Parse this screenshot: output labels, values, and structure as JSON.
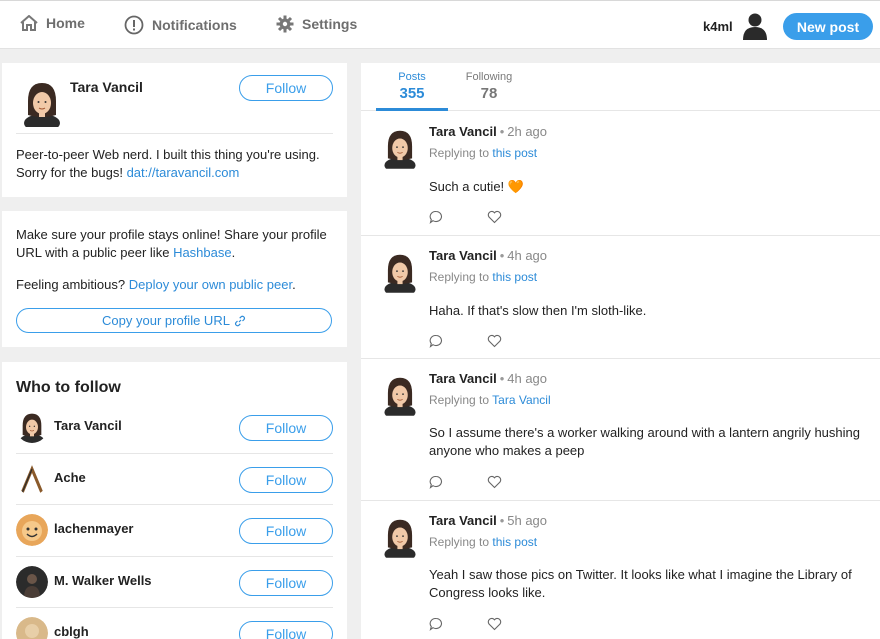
{
  "nav": {
    "home": "Home",
    "notifications": "Notifications",
    "settings": "Settings",
    "username": "k4ml",
    "new_post": "New post"
  },
  "profile": {
    "name": "Tara Vancil",
    "follow_label": "Follow",
    "bio": "Peer-to-peer Web nerd. I built this thing you're using. Sorry for the bugs!",
    "bio_link": "dat://taravancil.com"
  },
  "share": {
    "text1": "Make sure your profile stays online! Share your profile URL with a public peer like",
    "hashbase": "Hashbase",
    "text2": "Feeling ambitious?",
    "deploy_link": "Deploy your own public peer",
    "copy_btn": "Copy your profile URL"
  },
  "who_to_follow": {
    "title": "Who to follow",
    "items": [
      {
        "name": "Tara Vancil",
        "button": "Follow"
      },
      {
        "name": "Ache",
        "button": "Follow"
      },
      {
        "name": "lachenmayer",
        "button": "Follow"
      },
      {
        "name": "M. Walker Wells",
        "button": "Follow"
      },
      {
        "name": "cblgh",
        "button": "Follow"
      }
    ]
  },
  "tabs": {
    "posts_label": "Posts",
    "posts_count": "355",
    "following_label": "Following",
    "following_count": "78"
  },
  "posts": [
    {
      "author": "Tara Vancil",
      "time": "2h ago",
      "reply_prefix": "Replying to",
      "reply_target": "this post",
      "text": "Such a cutie! 🧡"
    },
    {
      "author": "Tara Vancil",
      "time": "4h ago",
      "reply_prefix": "Replying to",
      "reply_target": "this post",
      "text": "Haha. If that's slow then I'm sloth-like."
    },
    {
      "author": "Tara Vancil",
      "time": "4h ago",
      "reply_prefix": "Replying to",
      "reply_target": "Tara Vancil",
      "text": "So I assume there's a worker walking around with a lantern angrily hushing anyone who makes a peep"
    },
    {
      "author": "Tara Vancil",
      "time": "5h ago",
      "reply_prefix": "Replying to",
      "reply_target": "this post",
      "text": "Yeah I saw those pics on Twitter. It looks like what I imagine the Library of Congress looks like."
    }
  ],
  "colors": {
    "accent": "#3a9eea",
    "link": "#2c8bd8",
    "background": "#efefef"
  },
  "icons": {
    "home": "home-icon",
    "notifications": "notifications-icon",
    "settings": "gear-icon",
    "reply": "reply-icon",
    "like": "heart-icon",
    "link": "link-icon"
  }
}
